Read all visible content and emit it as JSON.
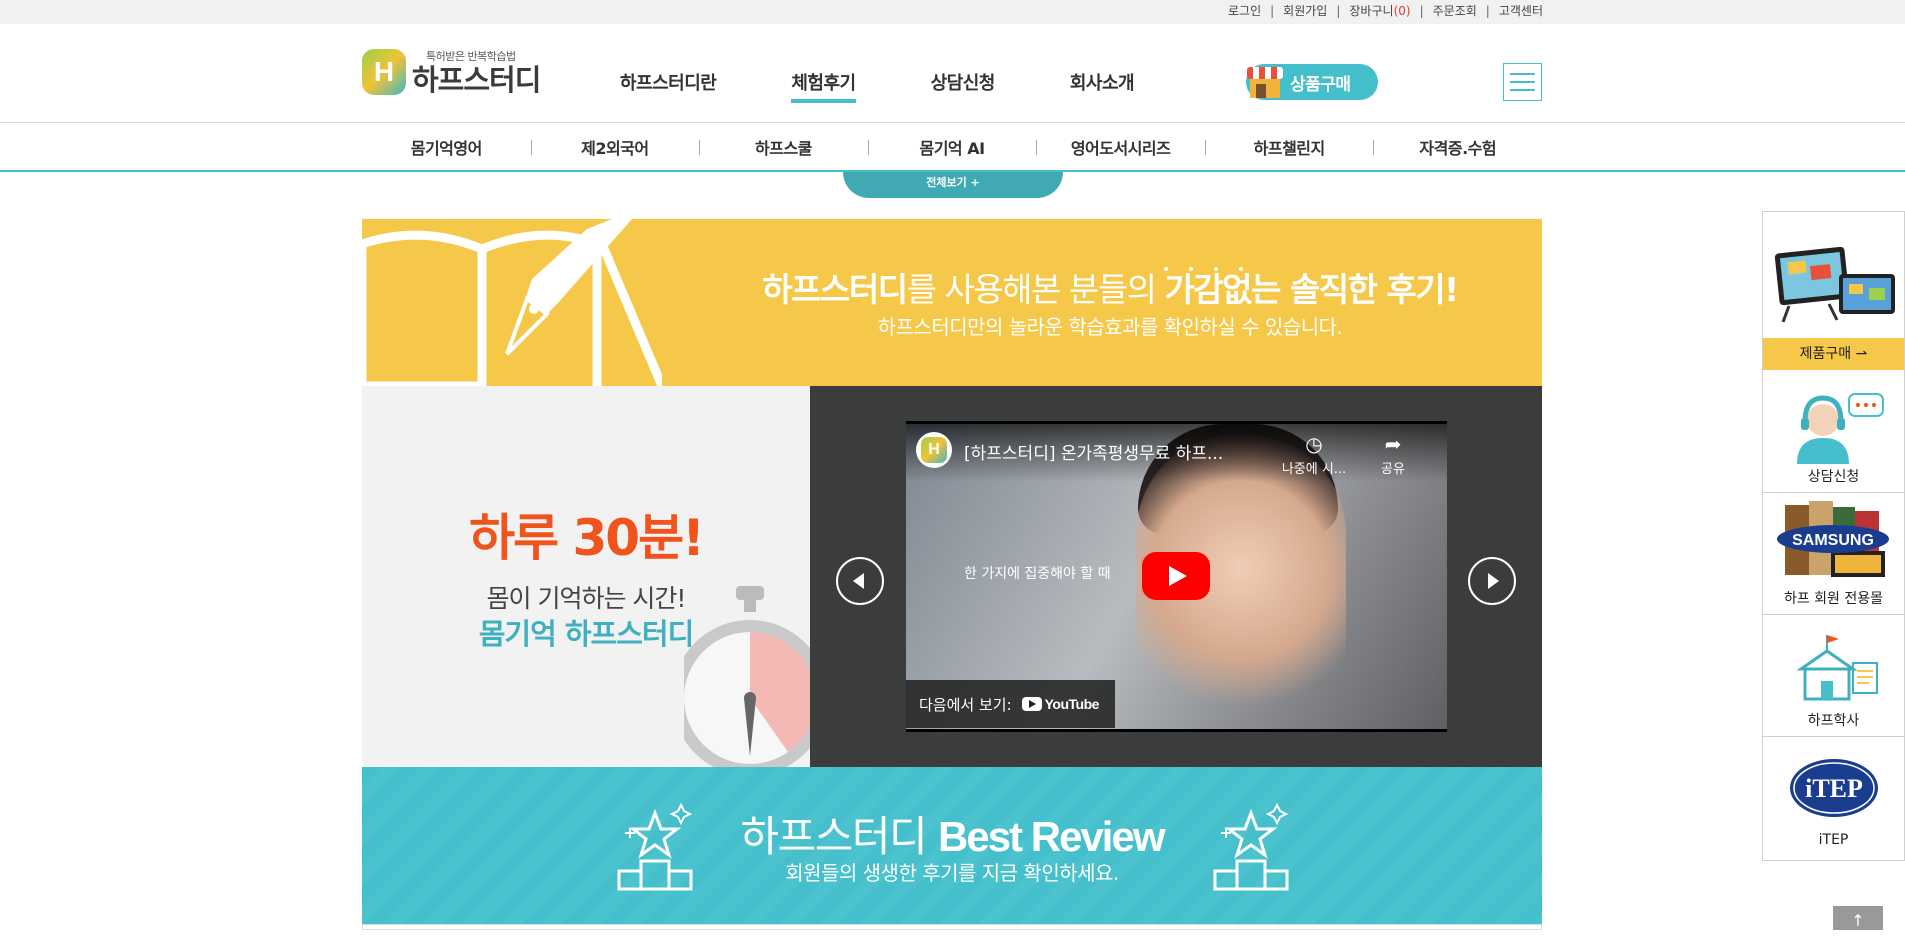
{
  "utility_nav": {
    "login": "로그인",
    "join": "회원가입",
    "cart": "장바구니",
    "cart_count": "(0)",
    "order": "주문조회",
    "support": "고객센터",
    "separator": "|"
  },
  "logo": {
    "tagline": "특허받은 반복학습법",
    "name": "하프스터디",
    "mark": "H"
  },
  "main_nav": {
    "items": [
      "하프스터디란",
      "체험후기",
      "상담신청",
      "회사소개"
    ],
    "active_index": 1,
    "shop_button": "상품구매"
  },
  "sub_nav": {
    "items": [
      "몸기억영어",
      "제2외국어",
      "하프스쿨",
      "몸기억 AI",
      "영어도서시리즈",
      "하프챌린지",
      "자격증.수험"
    ],
    "view_all": "전체보기 +"
  },
  "banner": {
    "title_brand": "하프스터디",
    "title_mid": "를 사용해본 분들의 ",
    "title_emph": "가감없는 솔직한 후기!",
    "subtitle": "하프스터디만의 놀라운 학습효과를 확인하실 수 있습니다."
  },
  "promo": {
    "headline": "하루 30분!",
    "line1": "몸이 기억하는 시간!",
    "line2": "몸기억 하프스터디"
  },
  "video": {
    "title": "[하프스터디] 온가족평생무료 하프...",
    "watch_later": "나중에 시...",
    "share": "공유",
    "caption": "한 가지에 집중해야 할 때",
    "watch_on": "다음에서 보기:",
    "youtube": "YouTube",
    "channel_mark": "H"
  },
  "best_review": {
    "title_brand": "하프스터디 ",
    "title_emph": "Best Review",
    "subtitle": "회원들의 생생한 후기를 지금 확인하세요."
  },
  "quick_menu": {
    "items": [
      "제품구매 ⇀",
      "상담신청",
      "하프 회원 전용몰",
      "하프학사",
      "iTEP"
    ],
    "samsung_logo": "SAMSUNG",
    "itep_logo": "iTEP"
  },
  "top_button": "↑",
  "colors": {
    "teal": "#46bfcc",
    "yellow": "#f5c84a",
    "orange": "#f0531c",
    "video_bg": "#3a3d3c"
  },
  "icons": [
    "book-pen-icon",
    "stopwatch-icon",
    "shop-icon",
    "hamburger-icon",
    "play-icon",
    "clock-icon",
    "share-icon",
    "prev-arrow-icon",
    "next-arrow-icon",
    "podium-star-icon",
    "tablet-icon",
    "counselor-icon",
    "samsung-logo",
    "school-icon",
    "itep-logo"
  ]
}
